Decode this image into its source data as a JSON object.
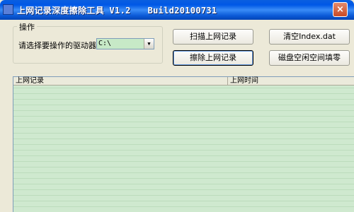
{
  "window": {
    "title": "上网记录深度擦除工具 V1.2",
    "build": "Build20100731",
    "close_glyph": "×"
  },
  "operation_group": {
    "legend": "操作",
    "drive_label": "请选择要操作的驱动器：",
    "drive_value": "C:\\",
    "dropdown_arrow": "▼"
  },
  "buttons": {
    "scan": "扫描上网记录",
    "clear_index": "清空Index.dat",
    "erase": "擦除上网记录",
    "fill_disk": "磁盘空闲空间填零"
  },
  "list": {
    "columns": [
      "上网记录",
      "上网时间"
    ]
  }
}
